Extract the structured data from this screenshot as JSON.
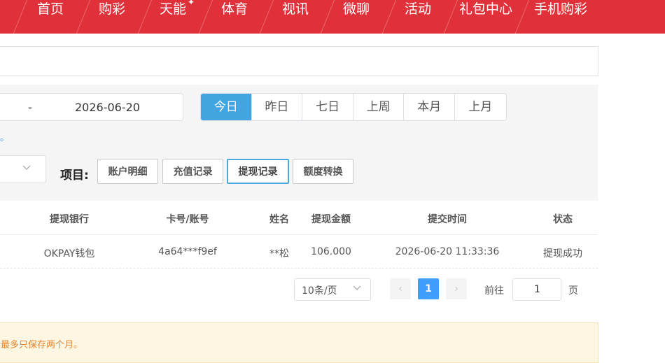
{
  "nav": {
    "items": [
      "首页",
      "购彩",
      "天能",
      "体育",
      "视讯",
      "微聊",
      "活动",
      "礼包中心",
      "手机购彩"
    ],
    "spark": "✦"
  },
  "filter": {
    "date_separator": "-",
    "date_end": "2026-06-20",
    "ranges": [
      "今日",
      "昨日",
      "七日",
      "上周",
      "本月",
      "上月"
    ],
    "active_range": "今日",
    "note_tail": "。",
    "project_label": "项目:",
    "projects": [
      "账户明细",
      "充值记录",
      "提现记录",
      "额度转换"
    ],
    "active_project": "提现记录"
  },
  "table": {
    "headers": [
      "提现银行",
      "卡号/账号",
      "姓名",
      "提现金额",
      "提交时间",
      "状态"
    ],
    "rows": [
      [
        "OKPAY钱包",
        "4a64***f9ef",
        "**松",
        "106.000",
        "2026-06-20 11:33:36",
        "提现成功"
      ]
    ]
  },
  "pagination": {
    "page_size": "10条/页",
    "prev": "‹",
    "current_page": "1",
    "next": "›",
    "goto_label": "前往",
    "goto_value": "1",
    "page_suffix": "页"
  },
  "notice": {
    "text": "最多只保存两个月。"
  },
  "colors": {
    "brand_red": "#e0313a",
    "active_blue": "#42a5e0",
    "notice_orange": "#e6852d"
  }
}
